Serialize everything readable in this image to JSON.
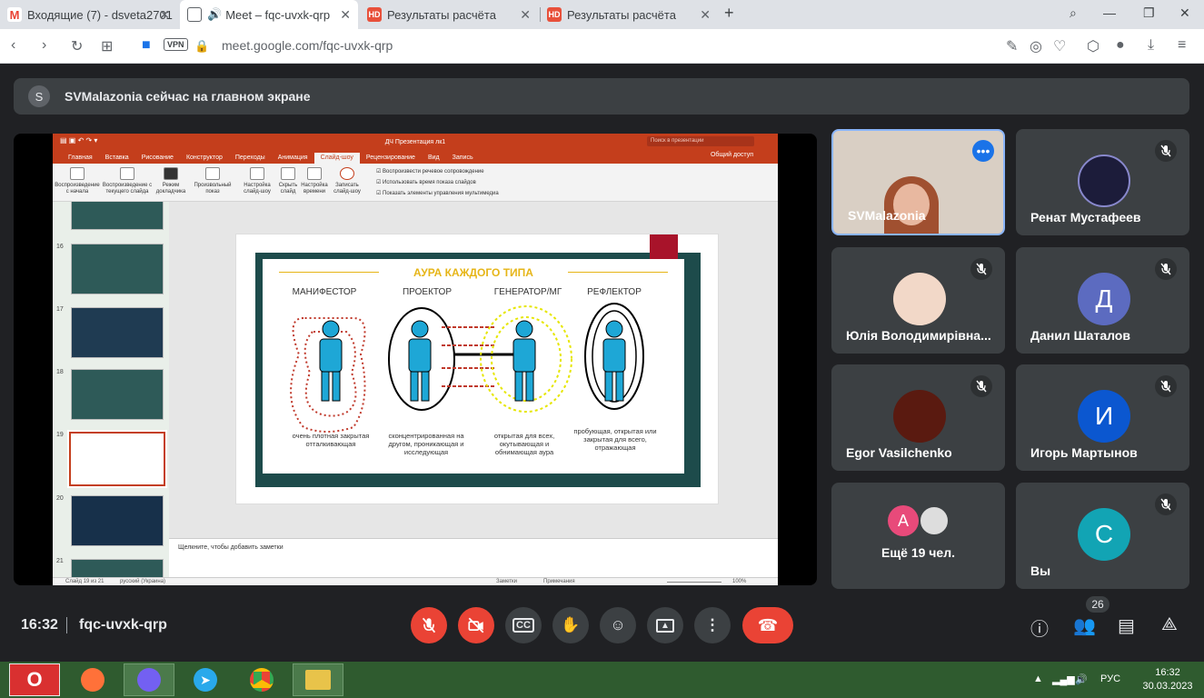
{
  "browser": {
    "tabs": [
      {
        "title": "Входящие (7) - dsveta2701",
        "icon": "gmail-icon",
        "active": false
      },
      {
        "title": "Meet – fqc-uvxk-qrp",
        "icon": "meet-icon",
        "active": true
      },
      {
        "title": "Результаты расчёта",
        "icon": "hd-icon",
        "active": false
      },
      {
        "title": "Результаты расчёта",
        "icon": "hd-icon",
        "active": false
      }
    ],
    "new_tab": "+",
    "vpn_label": "VPN",
    "url": "meet.google.com/fqc-uvxk-qrp"
  },
  "banner": {
    "avatar_letter": "S",
    "text": "SVMalazonia сейчас на главном экране"
  },
  "presentation": {
    "title": "ДЧ Презентация лк1",
    "search_placeholder": "Поиск в презентации",
    "share_label": "Общий доступ",
    "ribbon_tabs": [
      "Главная",
      "Вставка",
      "Рисование",
      "Конструктор",
      "Переходы",
      "Анимация",
      "Слайд-шоу",
      "Рецензирование",
      "Вид",
      "Запись"
    ],
    "active_tab": "Слайд-шоу",
    "ribbon_buttons": [
      "Воспроизведение с начала",
      "Воспроизведение с текущего слайда",
      "Режим докладчика",
      "Произвольный показ",
      "Настройка слайд-шоу",
      "Скрыть слайд",
      "Настройка времени",
      "Записать слайд-шоу"
    ],
    "ribbon_checks": [
      "Воспроизвести речевое сопровождение",
      "Использовать время показа слайдов",
      "Показать элементы управления мультимедиа"
    ],
    "slide_numbers": [
      "16",
      "17",
      "18",
      "19",
      "20",
      "21"
    ],
    "selected_slide": "19",
    "slide": {
      "title": "АУРА КАЖДОГО ТИПА",
      "headings": [
        "МАНИФЕСТОР",
        "ПРОЕКТОР",
        "ГЕНЕРАТОР/МГ",
        "РЕФЛЕКТОР"
      ],
      "captions": [
        "очень плотная закрытая отталкивающая",
        "сконцентрированная на другом, проникающая и исследующая",
        "открытая для всех, окутывающая и обнимающая аура",
        "пробующая, открытая или закрытая для всего, отражающая"
      ],
      "colors": {
        "frame": "#1d4b4b",
        "accent": "#e6b517",
        "figure": "#1ea7d6",
        "red": "#a8132a"
      }
    },
    "notes_placeholder": "Щелкните, чтобы добавить заметки",
    "status": {
      "slide": "Слайд 19 из 21",
      "language": "русский (Украина)",
      "notes": "Заметки",
      "comments": "Примечания",
      "zoom": "100%"
    }
  },
  "participants": [
    {
      "name": "SVMalazonia",
      "type": "video",
      "muted": false,
      "more": true
    },
    {
      "name": "Ренат Мустафеев",
      "type": "photo",
      "muted": true
    },
    {
      "name": "Юлія Володимирівна...",
      "type": "photo",
      "muted": true
    },
    {
      "name": "Данил Шаталов",
      "type": "letter",
      "letter": "Д",
      "color": "#5c6bc0",
      "muted": true
    },
    {
      "name": "Egor Vasilchenko",
      "type": "photo",
      "muted": true
    },
    {
      "name": "Игорь Мартынов",
      "type": "letter",
      "letter": "И",
      "color": "#0b57d0",
      "muted": true
    },
    {
      "name": "Ещё 19 чел.",
      "type": "more",
      "letter": "А",
      "color": "#e84a7a"
    },
    {
      "name": "Вы",
      "type": "letter",
      "letter": "С",
      "color": "#12a4b4",
      "muted": true
    }
  ],
  "meeting": {
    "time": "16:32",
    "code": "fqc-uvxk-qrp",
    "people_count": "26"
  },
  "taskbar": {
    "lang": "РУС",
    "time": "16:32",
    "date": "30.03.2023"
  }
}
